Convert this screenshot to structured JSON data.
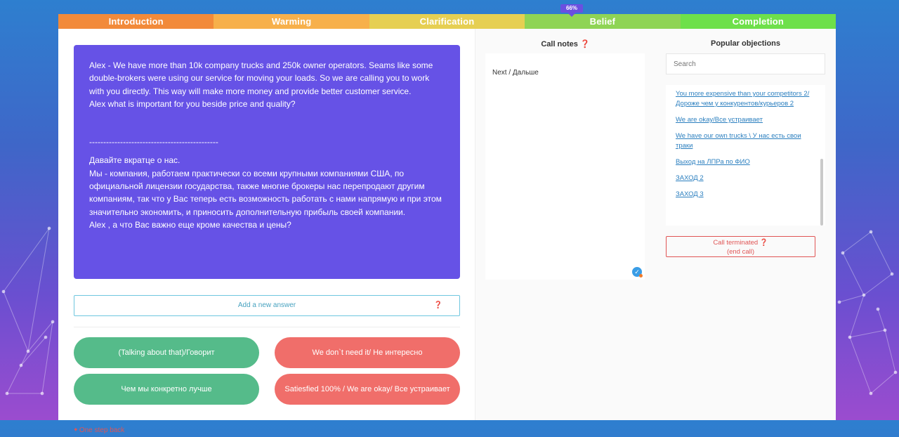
{
  "colors": {
    "stage_introduction": "#f28a3a",
    "stage_warming": "#f7b04b",
    "stage_clarification": "#e6cf52",
    "stage_belief": "#8fd455",
    "stage_completion": "#6ee04a",
    "script_bg": "#6652e6",
    "answer_positive": "#55bb8a",
    "answer_negative": "#f06e6a"
  },
  "progress": {
    "label": "66%",
    "value_percent": 66
  },
  "stages": [
    {
      "label": "Introduction"
    },
    {
      "label": "Warming"
    },
    {
      "label": "Clarification"
    },
    {
      "label": "Belief"
    },
    {
      "label": "Completion"
    }
  ],
  "script": {
    "en_paragraph": "Alex - We have more than 10k company trucks and 250k owner operators. Seams like some double-brokers were using our service for moving your loads. So we are calling you to work with you directly. This way will make more money and provide better customer service.",
    "en_question": "Alex what is important for you beside price and quality?",
    "divider": "----------------------------------------------",
    "ru_intro": "Давайте вкратце о нас.",
    "ru_paragraph": "Мы - компания, работаем практически со всеми крупными компаниями США, по официальной лицензии государства, также многие брокеры нас перепродают другим компаниям, так что у Вас теперь есть возможность работать с нами напрямую и при этом значительно экономить, и приносить дополнительную прибыль своей компании.",
    "ru_question": "Alex , а что Вас важно еще кроме качества и цены?"
  },
  "add_answer": {
    "label": "Add a new answer",
    "help_icon": "question-circle-icon"
  },
  "answers": [
    {
      "label": "(Talking about that)/Говорит",
      "type": "positive"
    },
    {
      "label": "We don`t need it/ Не интересно",
      "type": "negative"
    },
    {
      "label": "Чем мы конкретно лучше",
      "type": "positive"
    },
    {
      "label": "Satiesfied 100% / We are okay/ Все устраивает",
      "type": "negative"
    }
  ],
  "back_link": {
    "label": "One step back",
    "icon": "arrow-left-icon"
  },
  "call_notes": {
    "title": "Call notes",
    "content": "Next / Дальше",
    "help_icon": "question-circle-icon",
    "status_icon": "check-circle-icon"
  },
  "objections": {
    "title": "Popular objections",
    "search_placeholder": "Search",
    "items": [
      {
        "label": "You more expensive than your competitors 2/ Дороже чем у конкурентов/курьеров 2"
      },
      {
        "label": "We are okay/Все устраивает"
      },
      {
        "label": "We have our own trucks \\ У нас есть свои траки"
      },
      {
        "label": "Выход на ЛПРа по ФИО"
      },
      {
        "label": "ЗАХОД 2"
      },
      {
        "label": "ЗАХОД 3"
      }
    ]
  },
  "call_terminated": {
    "label": "Call terminated",
    "sublabel": "(end call)",
    "help_icon": "question-circle-icon"
  }
}
